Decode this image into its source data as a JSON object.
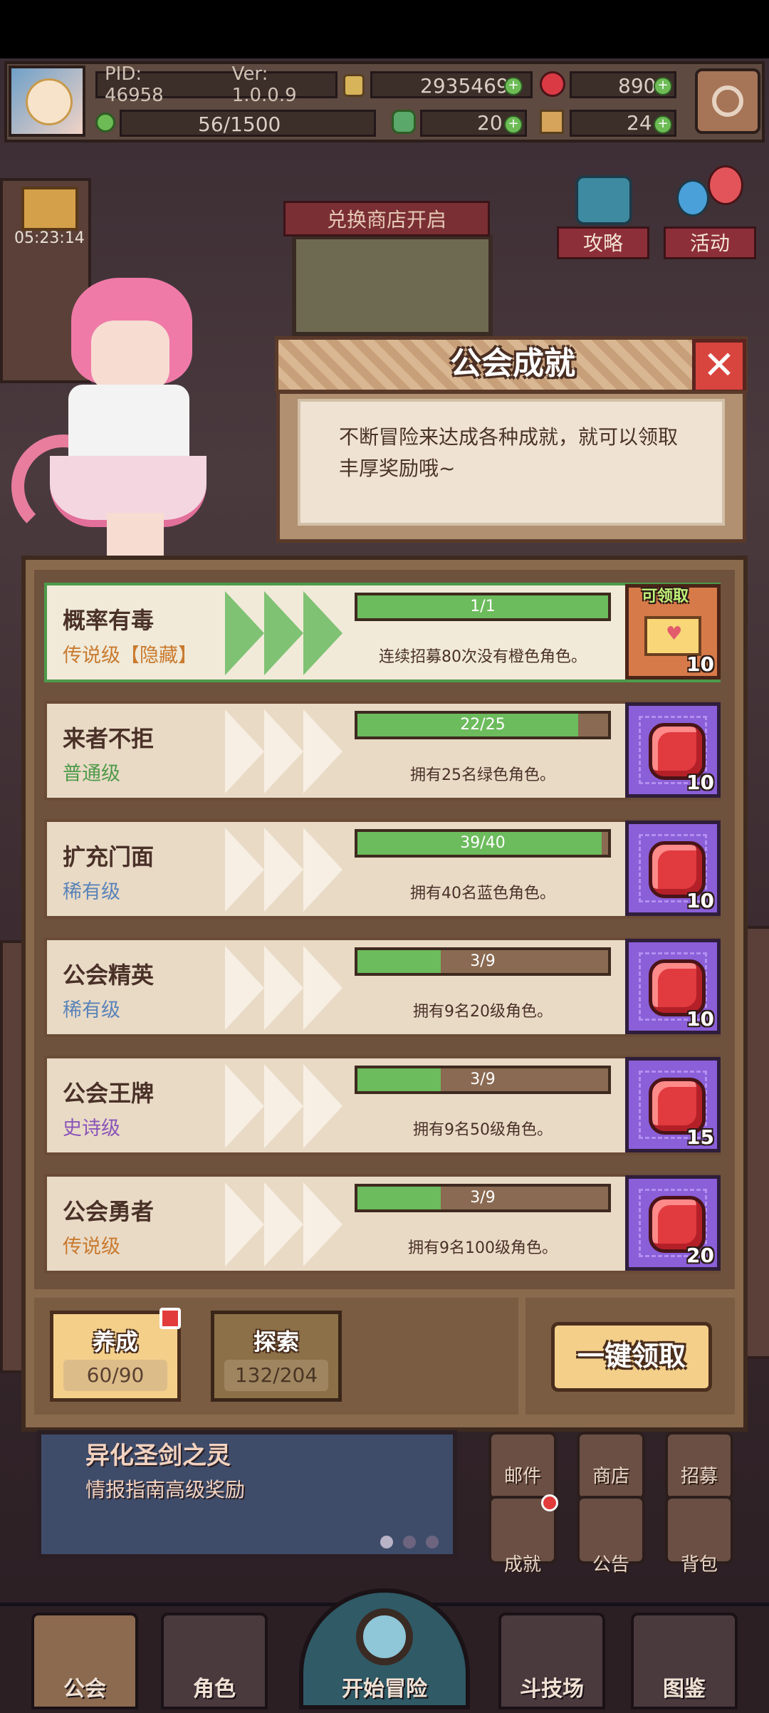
{
  "hud": {
    "pid": "PID: 46958",
    "version": "Ver: 1.0.0.9",
    "gold": "2935469",
    "gems": "890",
    "stamina": "56/1500",
    "clover": "20",
    "hammer": "24"
  },
  "timer": "05:23:14",
  "shop_banner": "兑换商店开启",
  "top_buttons": {
    "guide": "攻略",
    "event": "活动"
  },
  "popup": {
    "title": "公会成就",
    "close_symbol": "✕",
    "description_line1": "不断冒险来达成各种成就，就可以领取",
    "description_line2": "丰厚奖励哦~"
  },
  "achievements": [
    {
      "name": "概率有毒",
      "rarity": "传说级【隐藏】",
      "rarity_color": "#c97a2f",
      "progress_text": "1/1",
      "progress": 1.0,
      "desc": "连续招募80次没有橙色角色。",
      "reward_count": "10",
      "claim_label": "可领取",
      "claimable": true
    },
    {
      "name": "来者不拒",
      "rarity": "普通级",
      "rarity_color": "#4f9a4a",
      "progress_text": "22/25",
      "progress": 0.88,
      "desc": "拥有25名绿色角色。",
      "reward_count": "10",
      "claimable": false
    },
    {
      "name": "扩充门面",
      "rarity": "稀有级",
      "rarity_color": "#5a84b8",
      "progress_text": "39/40",
      "progress": 0.975,
      "desc": "拥有40名蓝色角色。",
      "reward_count": "10",
      "claimable": false
    },
    {
      "name": "公会精英",
      "rarity": "稀有级",
      "rarity_color": "#5a84b8",
      "progress_text": "3/9",
      "progress": 0.333,
      "desc": "拥有9名20级角色。",
      "reward_count": "10",
      "claimable": false
    },
    {
      "name": "公会王牌",
      "rarity": "史诗级",
      "rarity_color": "#8a55b8",
      "progress_text": "3/9",
      "progress": 0.333,
      "desc": "拥有9名50级角色。",
      "reward_count": "15",
      "claimable": false
    },
    {
      "name": "公会勇者",
      "rarity": "传说级",
      "rarity_color": "#c97a2f",
      "progress_text": "3/9",
      "progress": 0.333,
      "desc": "拥有9名100级角色。",
      "reward_count": "20",
      "claimable": false
    }
  ],
  "footer": {
    "tab_train": {
      "label": "养成",
      "count": "60/90"
    },
    "tab_explore": {
      "label": "探索",
      "count": "132/204"
    },
    "claim_all": "一键领取"
  },
  "promo": {
    "title": "异化圣剑之灵",
    "subtitle": "情报指南高级奖励"
  },
  "side_menu": {
    "mail": "邮件",
    "shop": "商店",
    "recruit": "招募",
    "achievement": "成就",
    "notice": "公告",
    "bag": "背包"
  },
  "bottom_nav": {
    "guild": "公会",
    "character": "角色",
    "start": "开始冒险",
    "arena": "斗技场",
    "codex": "图鉴"
  }
}
